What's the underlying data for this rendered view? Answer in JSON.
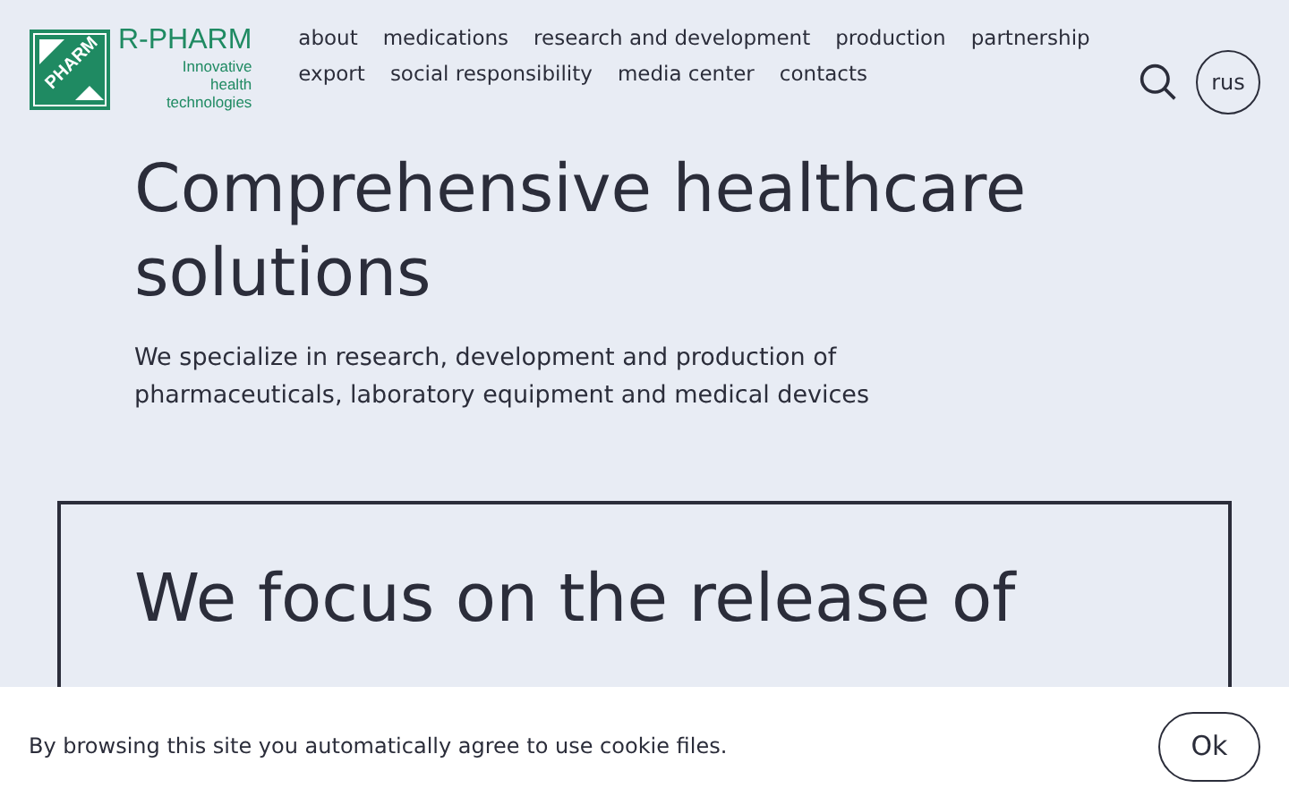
{
  "logo": {
    "mark": "PHARM",
    "name": "R-PHARM",
    "tagline": [
      "Innovative",
      "health",
      "technologies"
    ]
  },
  "nav": [
    [
      "about",
      "medications",
      "research and development",
      "production",
      "partnership"
    ],
    [
      "export",
      "social responsibility",
      "media center",
      "contacts"
    ]
  ],
  "language": "rus",
  "hero": {
    "title": "Comprehensive healthcare solutions",
    "text": "We specialize in research, development and production of pharmaceuticals, laboratory equipment and medical devices"
  },
  "card": {
    "title": "We focus on the release of"
  },
  "cookie": {
    "text": "By browsing this site you automatically agree to use cookie files.",
    "button": "Ok"
  }
}
